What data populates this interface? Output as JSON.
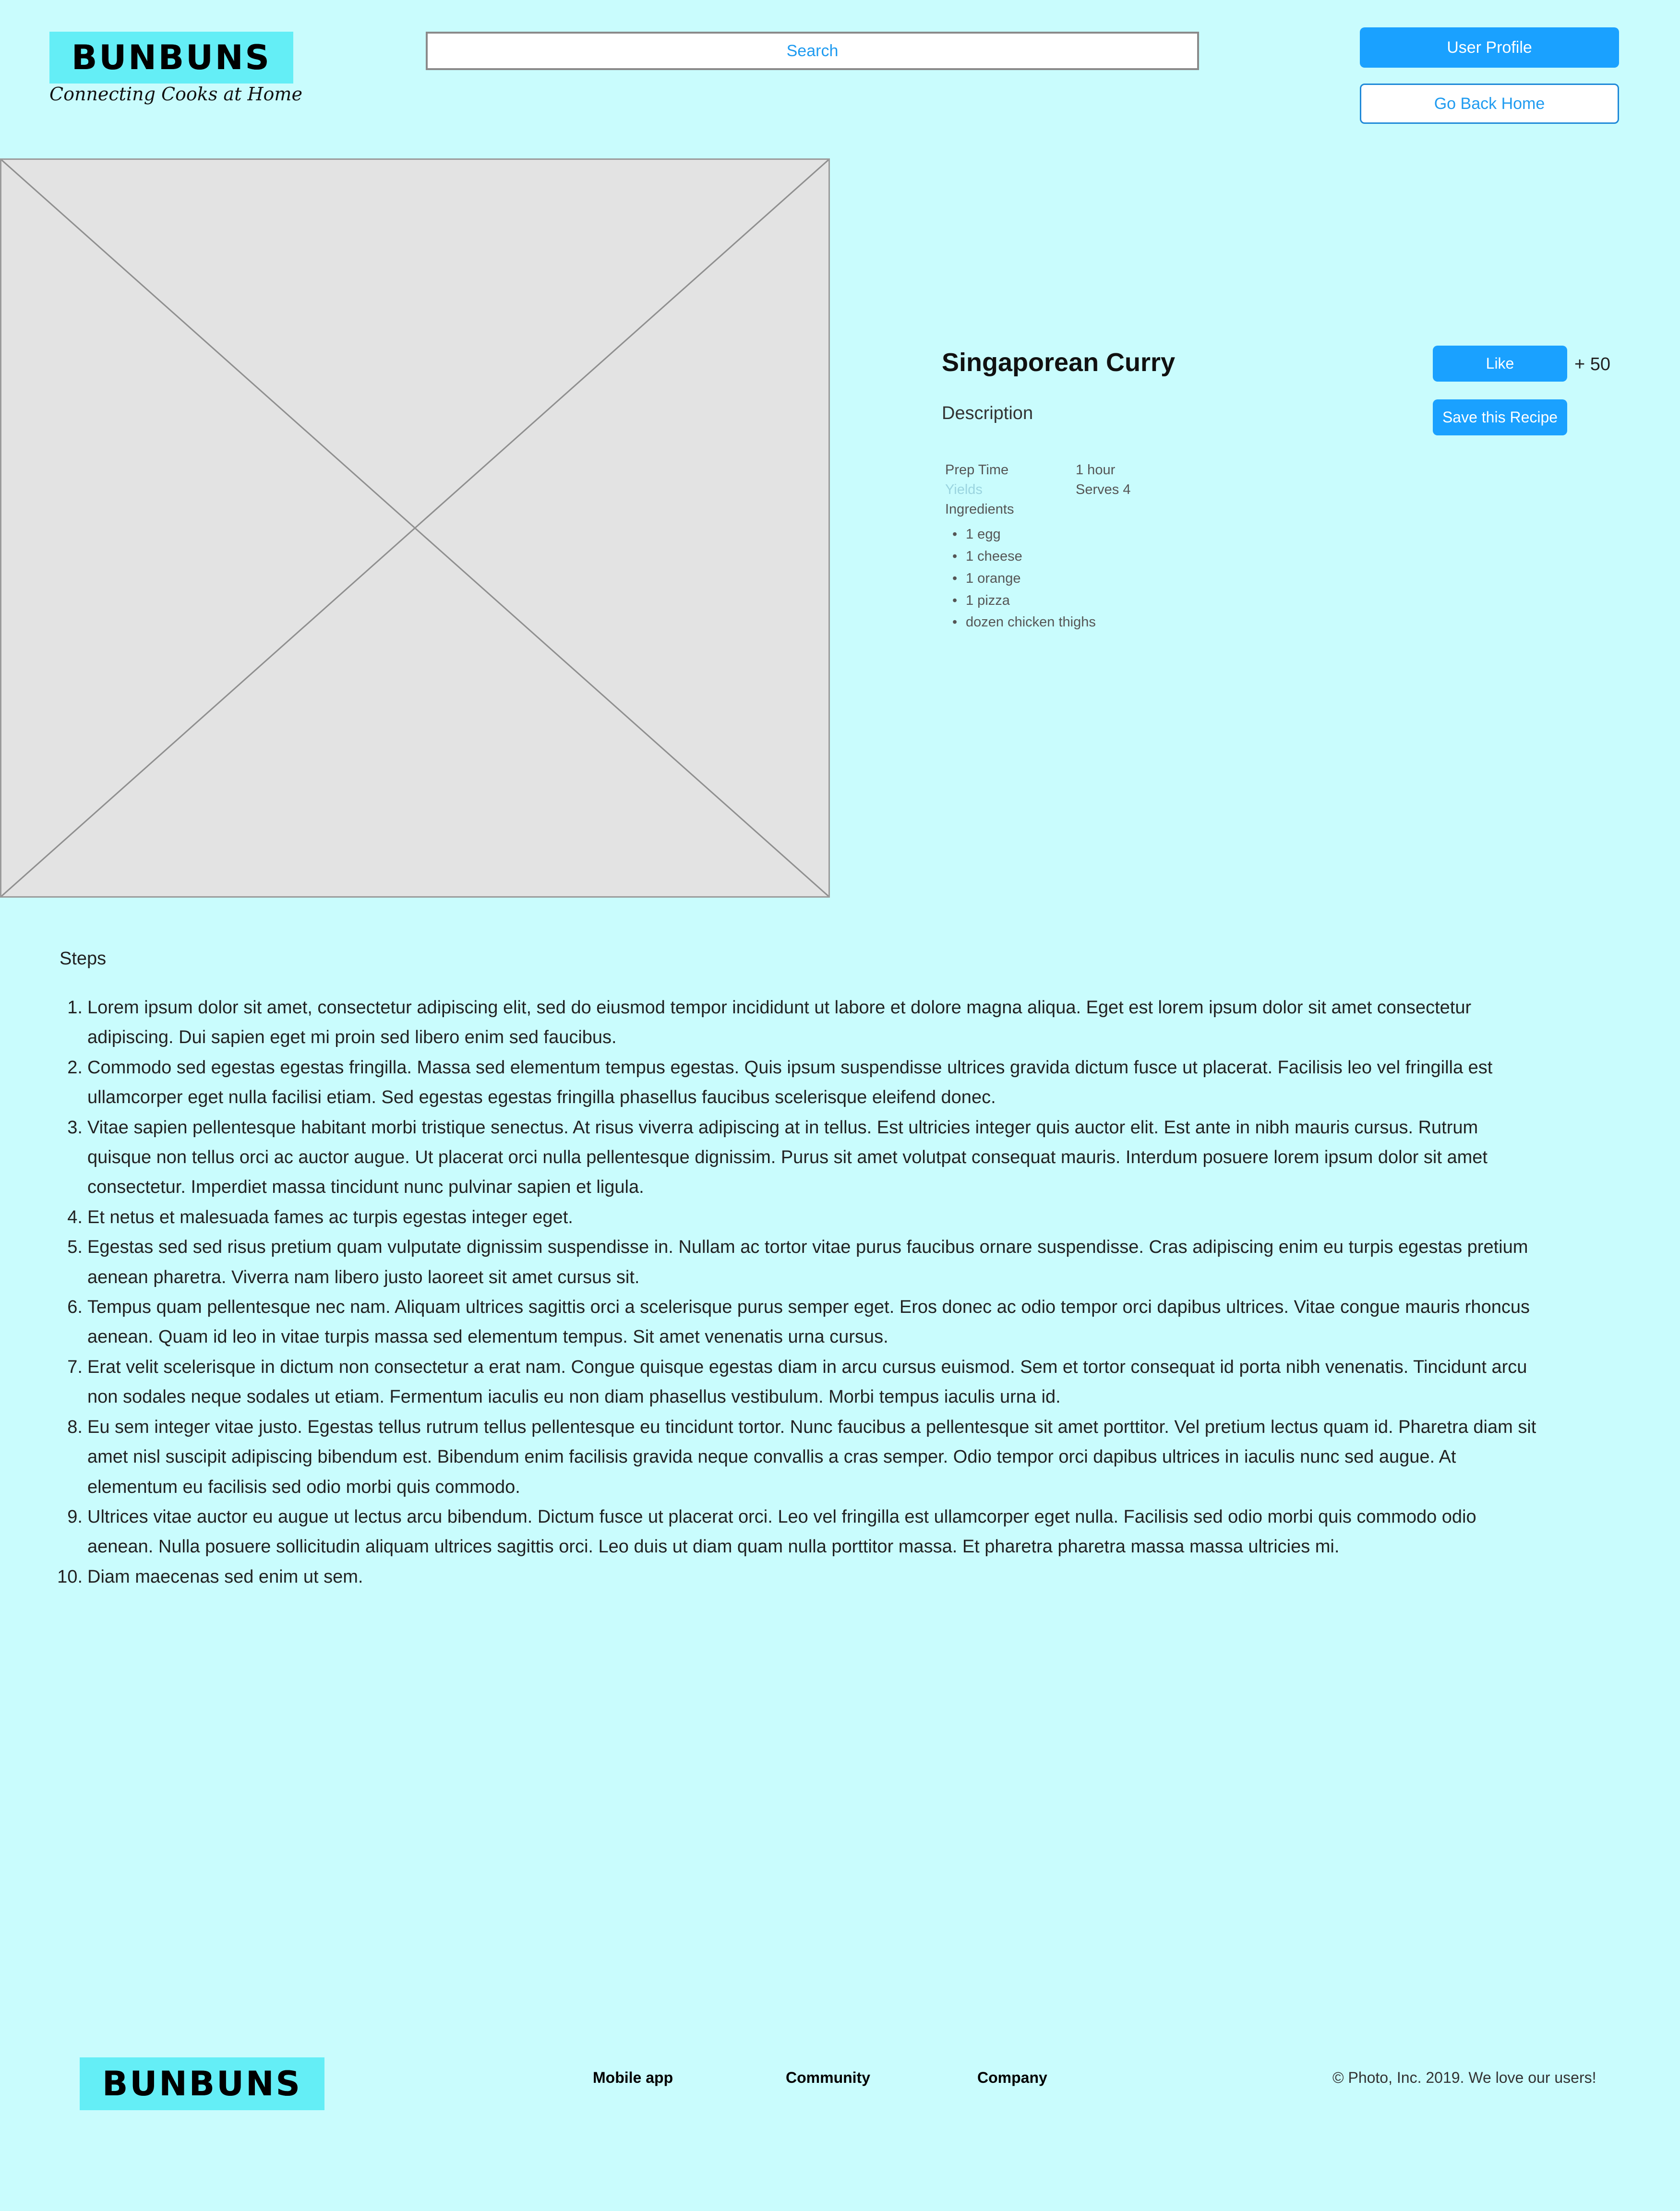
{
  "header": {
    "logo_text": "BUNBUNS",
    "tagline": "Connecting Cooks at Home",
    "search_label": "Search",
    "user_profile_label": "User Profile",
    "go_back_home_label": "Go Back Home"
  },
  "recipe": {
    "title": "Singaporean Curry",
    "description_label": "Description",
    "like_label": "Like",
    "like_count": "+ 50",
    "save_label": "Save this Recipe",
    "prep_time_label": "Prep Time",
    "prep_time_value": "1 hour",
    "yields_label": "Yields",
    "yields_value": "Serves 4",
    "ingredients_label": "Ingredients",
    "ingredients": [
      "1 egg",
      "1 cheese",
      "1 orange",
      "1 pizza",
      "dozen chicken thighs"
    ]
  },
  "steps": {
    "heading": "Steps",
    "items": [
      "Lorem ipsum dolor sit amet, consectetur adipiscing elit, sed do eiusmod tempor incididunt ut labore et dolore magna aliqua. Eget est lorem ipsum dolor sit amet consectetur adipiscing. Dui sapien eget mi proin sed libero enim sed faucibus.",
      "Commodo sed egestas egestas fringilla. Massa sed elementum tempus egestas. Quis ipsum suspendisse ultrices gravida dictum fusce ut placerat. Facilisis leo vel fringilla est ullamcorper eget nulla facilisi etiam. Sed egestas egestas fringilla phasellus faucibus scelerisque eleifend donec.",
      "Vitae sapien pellentesque habitant morbi tristique senectus. At risus viverra adipiscing at in tellus. Est ultricies integer quis auctor elit. Est ante in nibh mauris cursus. Rutrum quisque non tellus orci ac auctor augue. Ut placerat orci nulla pellentesque dignissim. Purus sit amet volutpat consequat mauris. Interdum posuere lorem ipsum dolor sit amet consectetur. Imperdiet massa tincidunt nunc pulvinar sapien et ligula.",
      "Et netus et malesuada fames ac turpis egestas integer eget.",
      "Egestas sed sed risus pretium quam vulputate dignissim suspendisse in. Nullam ac tortor vitae purus faucibus ornare suspendisse. Cras adipiscing enim eu turpis egestas pretium aenean pharetra. Viverra nam libero justo laoreet sit amet cursus sit.",
      "Tempus quam pellentesque nec nam. Aliquam ultrices sagittis orci a scelerisque purus semper eget. Eros donec ac odio tempor orci dapibus ultrices. Vitae congue mauris rhoncus aenean. Quam id leo in vitae turpis massa sed elementum tempus. Sit amet venenatis urna cursus.",
      "Erat velit scelerisque in dictum non consectetur a erat nam. Congue quisque egestas diam in arcu cursus euismod. Sem et tortor consequat id porta nibh venenatis. Tincidunt arcu non sodales neque sodales ut etiam. Fermentum iaculis eu non diam phasellus vestibulum. Morbi tempus iaculis urna id.",
      "Eu sem integer vitae justo. Egestas tellus rutrum tellus pellentesque eu tincidunt tortor. Nunc faucibus a pellentesque sit amet porttitor. Vel pretium lectus quam id. Pharetra diam sit amet nisl suscipit adipiscing bibendum est. Bibendum enim facilisis gravida neque convallis a cras semper. Odio tempor orci dapibus ultrices in iaculis nunc sed augue. At elementum eu facilisis sed odio morbi quis commodo.",
      "Ultrices vitae auctor eu augue ut lectus arcu bibendum. Dictum fusce ut placerat orci. Leo vel fringilla est ullamcorper eget nulla. Facilisis sed odio morbi quis commodo odio aenean. Nulla posuere sollicitudin aliquam ultrices sagittis orci. Leo duis ut diam quam nulla porttitor massa. Et pharetra pharetra massa massa ultricies mi.",
      "Diam maecenas sed enim ut sem."
    ]
  },
  "footer": {
    "logo_text": "BUNBUNS",
    "links": [
      "Mobile app",
      "Community",
      "Company"
    ],
    "copyright": "© Photo, Inc. 2019. We love our users!"
  },
  "colors": {
    "background": "#c9fcfd",
    "logo_background": "#64eef6",
    "accent": "#1aa1ff",
    "placeholder": "#e3e3e3"
  },
  "icons": {
    "image_placeholder": "image-placeholder-icon"
  }
}
